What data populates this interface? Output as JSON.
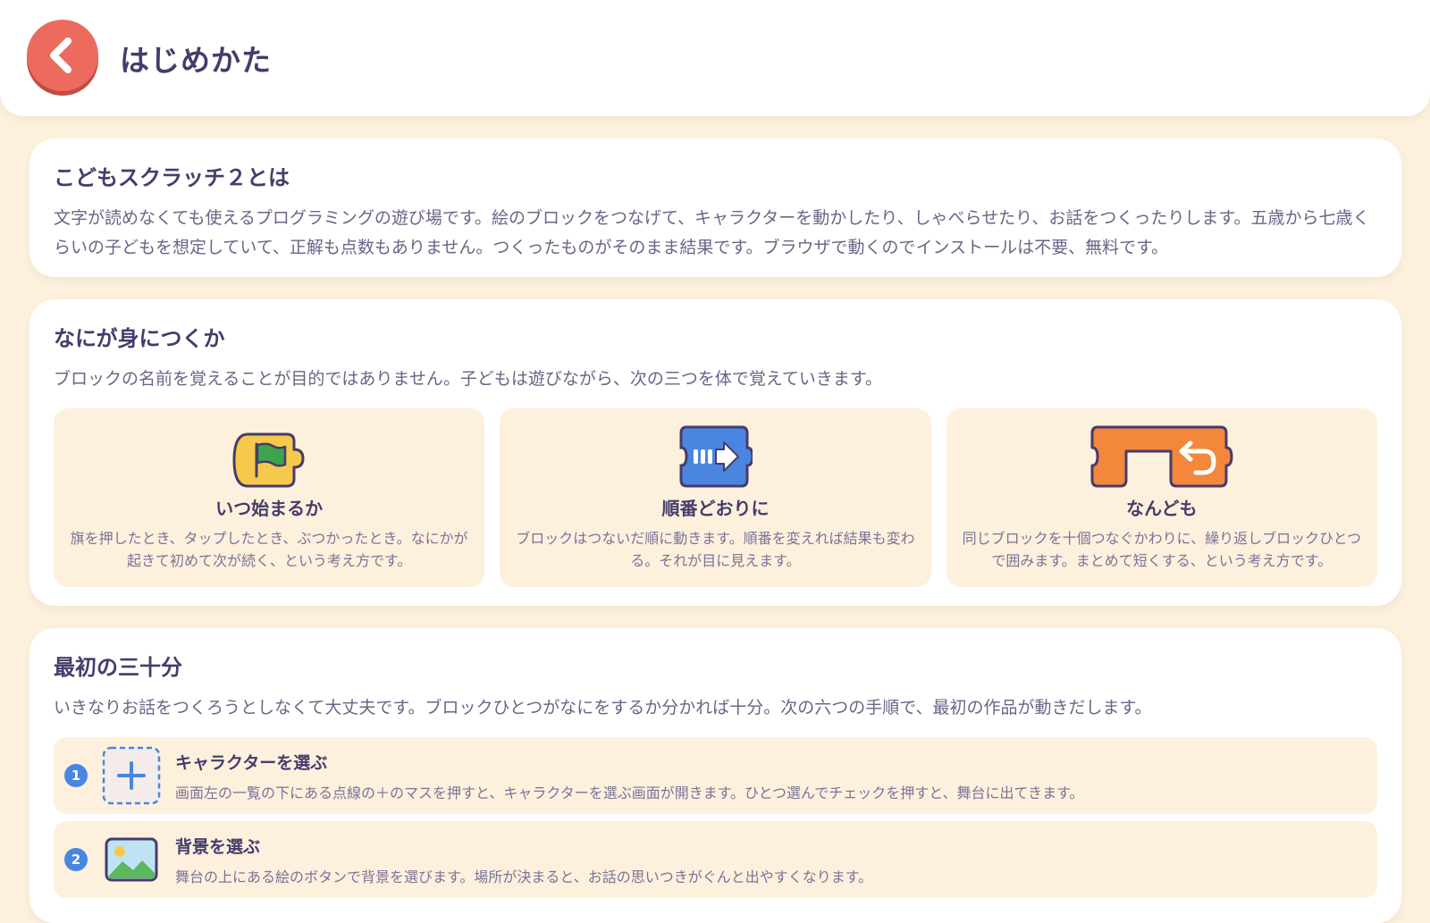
{
  "header": {
    "title": "はじめかた",
    "back_icon": "chevron-left-icon"
  },
  "about": {
    "title": "こどもスクラッチ２とは",
    "body": "文字が読めなくても使えるプログラミングの遊び場です。絵のブロックをつなげて、キャラクターを動かしたり、しゃべらせたり、お話をつくったりします。五歳から七歳くらいの子どもを想定していて、正解も点数もありません。つくったものがそのまま結果です。ブラウザで動くのでインストールは不要、無料です。"
  },
  "skills": {
    "title": "なにが身につくか",
    "lead": "ブロックの名前を覚えることが目的ではありません。子どもは遊びながら、次の三つを体で覚えていきます。",
    "items": [
      {
        "icon": "green-flag-block-icon",
        "title": "いつ始まるか",
        "body": "旗を押したとき、タップしたとき、ぶつかったとき。なにかが起きて初めて次が続く、という考え方です。"
      },
      {
        "icon": "move-right-block-icon",
        "title": "順番どおりに",
        "body": "ブロックはつないだ順に動きます。順番を変えれば結果も変わる。それが目に見えます。"
      },
      {
        "icon": "repeat-block-icon",
        "title": "なんども",
        "body": "同じブロックを十個つなぐかわりに、繰り返しブロックひとつで囲みます。まとめて短くする、という考え方です。"
      }
    ]
  },
  "first": {
    "title": "最初の三十分",
    "lead": "いきなりお話をつくろうとしなくて大丈夫です。ブロックひとつがなにをするか分かれば十分。次の六つの手順で、最初の作品が動きだします。",
    "steps": [
      {
        "num": "1",
        "icon": "add-character-icon",
        "title": "キャラクターを選ぶ",
        "body": "画面左の一覧の下にある点線の＋のマスを押すと、キャラクターを選ぶ画面が開きます。ひとつ選んでチェックを押すと、舞台に出てきます。"
      },
      {
        "num": "2",
        "icon": "background-image-icon",
        "title": "背景を選ぶ",
        "body": "舞台の上にある絵のボタンで背景を選びます。場所が決まると、お話の思いつきがぐんと出やすくなります。"
      }
    ]
  },
  "colors": {
    "page_bg": "#fdf1de",
    "card_bg": "#ffffff",
    "text": "#463c6a",
    "back_button": "#ec6a5e",
    "flag_block": "#f6c94d",
    "motion_block": "#4a86e0",
    "control_block": "#f3873c",
    "step_badge": "#4a86e0"
  }
}
